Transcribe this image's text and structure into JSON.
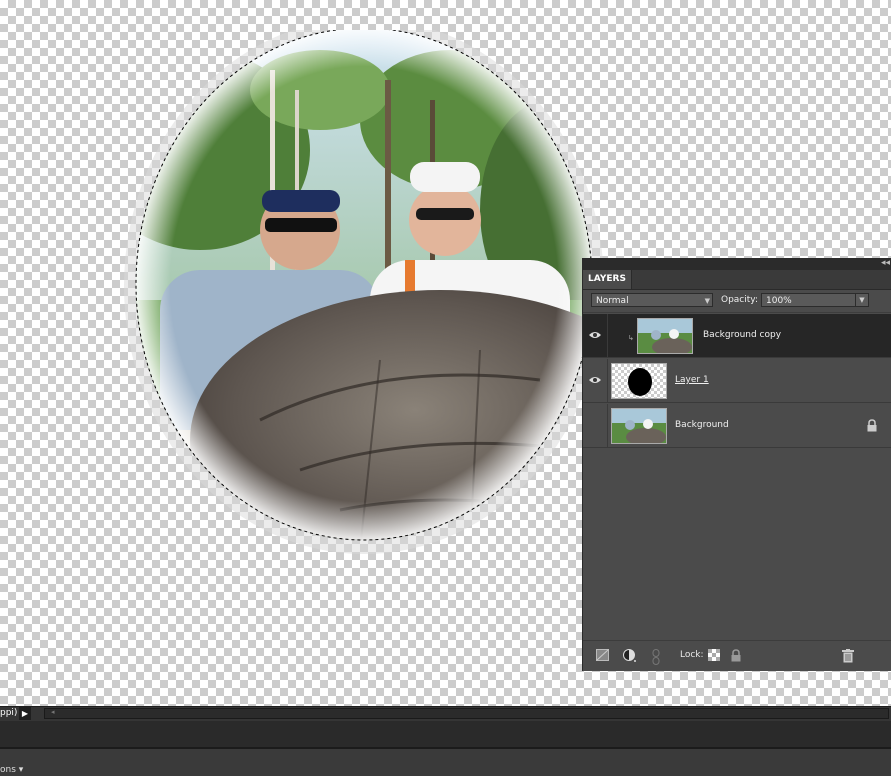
{
  "layers_panel": {
    "tab_label": "LAYERS",
    "blend_mode": "Normal",
    "opacity_label": "Opacity:",
    "opacity_value": "100%",
    "layers": [
      {
        "name": "Background copy",
        "visible": true,
        "selected": true,
        "thumbnail": "photo"
      },
      {
        "name": "Layer 1",
        "visible": true,
        "selected": false,
        "thumbnail": "black-ellipse-mask"
      },
      {
        "name": "Background",
        "visible": false,
        "selected": false,
        "thumbnail": "photo",
        "locked": true
      }
    ],
    "lock_label": "Lock:"
  },
  "status_bar": {
    "zoom_text": "ppi)"
  },
  "lower_bar": {
    "options_label": "ons"
  },
  "colors": {
    "panel_bg": "#4b4b4b",
    "selected_row": "#262626",
    "canvas_check": "#cccccc"
  }
}
